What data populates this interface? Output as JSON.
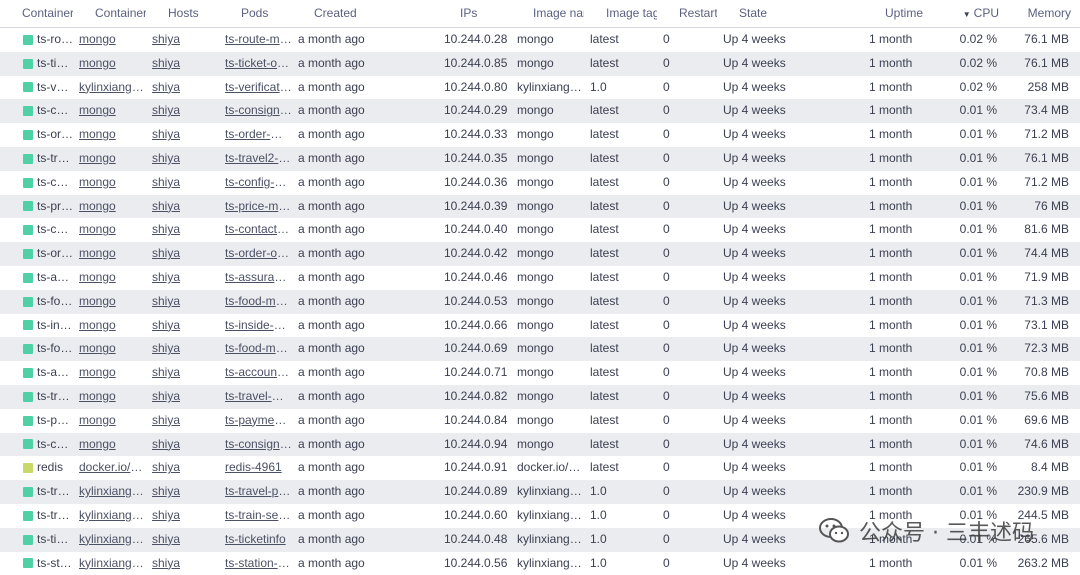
{
  "columns": [
    "Containers",
    "Containers by",
    "Hosts",
    "Pods",
    "Created",
    "IPs",
    "Image name",
    "Image tag",
    "Restart #",
    "State",
    "Uptime",
    "CPU",
    "Memory"
  ],
  "sort_icon": "sort-desc-icon",
  "colors": {
    "teal": "#4fd1a5",
    "olive": "#c8d968"
  },
  "rows": [
    {
      "color": "teal",
      "container": "ts-route-mongo",
      "by": "mongo",
      "host": "shiya",
      "pod": "ts-route-mongo",
      "created": "a month ago",
      "ip": "10.244.0.28",
      "image": "mongo",
      "tag": "latest",
      "restart": "0",
      "state": "Up 4 weeks",
      "uptime": "1 month",
      "cpu": "0.02 %",
      "mem": "76.1 MB"
    },
    {
      "color": "teal",
      "container": "ts-ticket-office-mongo",
      "by": "mongo",
      "host": "shiya",
      "pod": "ts-ticket-office-mongo",
      "created": "a month ago",
      "ip": "10.244.0.85",
      "image": "mongo",
      "tag": "latest",
      "restart": "0",
      "state": "Up 4 weeks",
      "uptime": "1 month",
      "cpu": "0.02 %",
      "mem": "76.1 MB"
    },
    {
      "color": "teal",
      "container": "ts-verification-code",
      "by": "kylinxiang/ts-verification",
      "host": "shiya",
      "pod": "ts-verification-code",
      "created": "a month ago",
      "ip": "10.244.0.80",
      "image": "kylinxiang/ts-verification",
      "tag": "1.0",
      "restart": "0",
      "state": "Up 4 weeks",
      "uptime": "1 month",
      "cpu": "0.02 %",
      "mem": "258 MB"
    },
    {
      "color": "teal",
      "container": "ts-consign-mongo",
      "by": "mongo",
      "host": "shiya",
      "pod": "ts-consign-mongo",
      "created": "a month ago",
      "ip": "10.244.0.29",
      "image": "mongo",
      "tag": "latest",
      "restart": "0",
      "state": "Up 4 weeks",
      "uptime": "1 month",
      "cpu": "0.01 %",
      "mem": "73.4 MB"
    },
    {
      "color": "teal",
      "container": "ts-order-mongo",
      "by": "mongo",
      "host": "shiya",
      "pod": "ts-order-mongo",
      "created": "a month ago",
      "ip": "10.244.0.33",
      "image": "mongo",
      "tag": "latest",
      "restart": "0",
      "state": "Up 4 weeks",
      "uptime": "1 month",
      "cpu": "0.01 %",
      "mem": "71.2 MB"
    },
    {
      "color": "teal",
      "container": "ts-travel2-mongo",
      "by": "mongo",
      "host": "shiya",
      "pod": "ts-travel2-mongo",
      "created": "a month ago",
      "ip": "10.244.0.35",
      "image": "mongo",
      "tag": "latest",
      "restart": "0",
      "state": "Up 4 weeks",
      "uptime": "1 month",
      "cpu": "0.01 %",
      "mem": "76.1 MB"
    },
    {
      "color": "teal",
      "container": "ts-config-mongo",
      "by": "mongo",
      "host": "shiya",
      "pod": "ts-config-mongo",
      "created": "a month ago",
      "ip": "10.244.0.36",
      "image": "mongo",
      "tag": "latest",
      "restart": "0",
      "state": "Up 4 weeks",
      "uptime": "1 month",
      "cpu": "0.01 %",
      "mem": "71.2 MB"
    },
    {
      "color": "teal",
      "container": "ts-price-mongo",
      "by": "mongo",
      "host": "shiya",
      "pod": "ts-price-mongo",
      "created": "a month ago",
      "ip": "10.244.0.39",
      "image": "mongo",
      "tag": "latest",
      "restart": "0",
      "state": "Up 4 weeks",
      "uptime": "1 month",
      "cpu": "0.01 %",
      "mem": "76 MB"
    },
    {
      "color": "teal",
      "container": "ts-contacts-mongo",
      "by": "mongo",
      "host": "shiya",
      "pod": "ts-contacts-mongo",
      "created": "a month ago",
      "ip": "10.244.0.40",
      "image": "mongo",
      "tag": "latest",
      "restart": "0",
      "state": "Up 4 weeks",
      "uptime": "1 month",
      "cpu": "0.01 %",
      "mem": "81.6 MB"
    },
    {
      "color": "teal",
      "container": "ts-order-other-mongo",
      "by": "mongo",
      "host": "shiya",
      "pod": "ts-order-other-mongo",
      "created": "a month ago",
      "ip": "10.244.0.42",
      "image": "mongo",
      "tag": "latest",
      "restart": "0",
      "state": "Up 4 weeks",
      "uptime": "1 month",
      "cpu": "0.01 %",
      "mem": "74.4 MB"
    },
    {
      "color": "teal",
      "container": "ts-assurance-mongo",
      "by": "mongo",
      "host": "shiya",
      "pod": "ts-assurance-mongo",
      "created": "a month ago",
      "ip": "10.244.0.46",
      "image": "mongo",
      "tag": "latest",
      "restart": "0",
      "state": "Up 4 weeks",
      "uptime": "1 month",
      "cpu": "0.01 %",
      "mem": "71.9 MB"
    },
    {
      "color": "teal",
      "container": "ts-food-mongo",
      "by": "mongo",
      "host": "shiya",
      "pod": "ts-food-mongo",
      "created": "a month ago",
      "ip": "10.244.0.53",
      "image": "mongo",
      "tag": "latest",
      "restart": "0",
      "state": "Up 4 weeks",
      "uptime": "1 month",
      "cpu": "0.01 %",
      "mem": "71.3 MB"
    },
    {
      "color": "teal",
      "container": "ts-inside-payment-mongo",
      "by": "mongo",
      "host": "shiya",
      "pod": "ts-inside-payment-mongo",
      "created": "a month ago",
      "ip": "10.244.0.66",
      "image": "mongo",
      "tag": "latest",
      "restart": "0",
      "state": "Up 4 weeks",
      "uptime": "1 month",
      "cpu": "0.01 %",
      "mem": "73.1 MB"
    },
    {
      "color": "teal",
      "container": "ts-food-map-mongo",
      "by": "mongo",
      "host": "shiya",
      "pod": "ts-food-map-mongo",
      "created": "a month ago",
      "ip": "10.244.0.69",
      "image": "mongo",
      "tag": "latest",
      "restart": "0",
      "state": "Up 4 weeks",
      "uptime": "1 month",
      "cpu": "0.01 %",
      "mem": "72.3 MB"
    },
    {
      "color": "teal",
      "container": "ts-account-mongo",
      "by": "mongo",
      "host": "shiya",
      "pod": "ts-account-mongo",
      "created": "a month ago",
      "ip": "10.244.0.71",
      "image": "mongo",
      "tag": "latest",
      "restart": "0",
      "state": "Up 4 weeks",
      "uptime": "1 month",
      "cpu": "0.01 %",
      "mem": "70.8 MB"
    },
    {
      "color": "teal",
      "container": "ts-travel-mongo",
      "by": "mongo",
      "host": "shiya",
      "pod": "ts-travel-mongo",
      "created": "a month ago",
      "ip": "10.244.0.82",
      "image": "mongo",
      "tag": "latest",
      "restart": "0",
      "state": "Up 4 weeks",
      "uptime": "1 month",
      "cpu": "0.01 %",
      "mem": "75.6 MB"
    },
    {
      "color": "teal",
      "container": "ts-payment-mongo",
      "by": "mongo",
      "host": "shiya",
      "pod": "ts-payment-mongo",
      "created": "a month ago",
      "ip": "10.244.0.84",
      "image": "mongo",
      "tag": "latest",
      "restart": "0",
      "state": "Up 4 weeks",
      "uptime": "1 month",
      "cpu": "0.01 %",
      "mem": "69.6 MB"
    },
    {
      "color": "teal",
      "container": "ts-consign-price-mongo",
      "by": "mongo",
      "host": "shiya",
      "pod": "ts-consign-price-mongo",
      "created": "a month ago",
      "ip": "10.244.0.94",
      "image": "mongo",
      "tag": "latest",
      "restart": "0",
      "state": "Up 4 weeks",
      "uptime": "1 month",
      "cpu": "0.01 %",
      "mem": "74.6 MB"
    },
    {
      "color": "olive",
      "container": "redis",
      "by": "docker.io/redis",
      "host": "shiya",
      "pod": "redis-4961",
      "created": "a month ago",
      "ip": "10.244.0.91",
      "image": "docker.io/redis",
      "tag": "latest",
      "restart": "0",
      "state": "Up 4 weeks",
      "uptime": "1 month",
      "cpu": "0.01 %",
      "mem": "8.4 MB"
    },
    {
      "color": "teal",
      "container": "ts-travel-plan",
      "by": "kylinxiang/ts-travel-plan",
      "host": "shiya",
      "pod": "ts-travel-plan",
      "created": "a month ago",
      "ip": "10.244.0.89",
      "image": "kylinxiang/ts-travel-plan",
      "tag": "1.0",
      "restart": "0",
      "state": "Up 4 weeks",
      "uptime": "1 month",
      "cpu": "0.01 %",
      "mem": "230.9 MB"
    },
    {
      "color": "teal",
      "container": "ts-train-service",
      "by": "kylinxiang/ts-train",
      "host": "shiya",
      "pod": "ts-train-service",
      "created": "a month ago",
      "ip": "10.244.0.60",
      "image": "kylinxiang/ts-train",
      "tag": "1.0",
      "restart": "0",
      "state": "Up 4 weeks",
      "uptime": "1 month",
      "cpu": "0.01 %",
      "mem": "244.5 MB"
    },
    {
      "color": "teal",
      "container": "ts-ticketinfo",
      "by": "kylinxiang/ts-ticketinfo",
      "host": "shiya",
      "pod": "ts-ticketinfo",
      "created": "a month ago",
      "ip": "10.244.0.48",
      "image": "kylinxiang/ts-ticketinfo",
      "tag": "1.0",
      "restart": "0",
      "state": "Up 4 weeks",
      "uptime": "1 month",
      "cpu": "0.01 %",
      "mem": "265.6 MB"
    },
    {
      "color": "teal",
      "container": "ts-station-service",
      "by": "kylinxiang/ts-station",
      "host": "shiya",
      "pod": "ts-station-service",
      "created": "a month ago",
      "ip": "10.244.0.56",
      "image": "kylinxiang/ts-station",
      "tag": "1.0",
      "restart": "0",
      "state": "Up 4 weeks",
      "uptime": "1 month",
      "cpu": "0.01 %",
      "mem": "263.2 MB"
    }
  ],
  "watermark": {
    "text": "公众号 · 三丰述码"
  }
}
